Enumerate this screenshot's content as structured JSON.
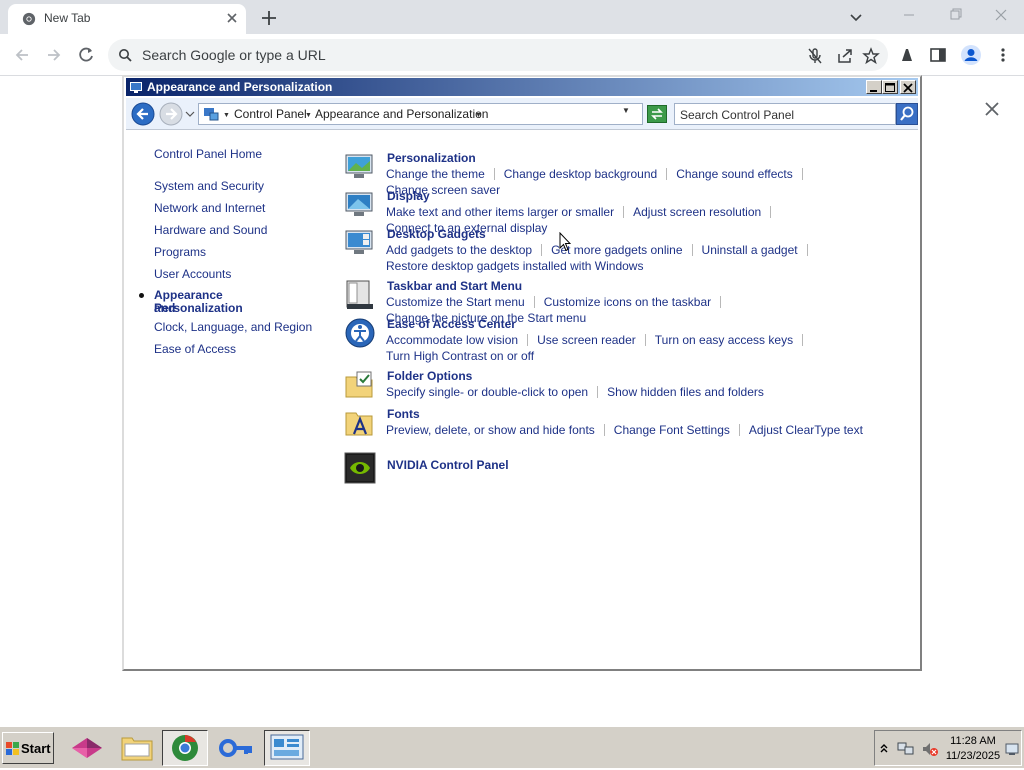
{
  "browser": {
    "tab_title": "New Tab",
    "omnibox_placeholder": "Search Google or type a URL",
    "icons": [
      "chrome-icon",
      "close-icon",
      "plus-icon",
      "chevron-down-icon",
      "minimize-icon",
      "restore-icon",
      "close-icon",
      "back-arrow-icon",
      "forward-arrow-icon",
      "reload-icon",
      "search-icon",
      "mic-off-icon",
      "share-icon",
      "star-icon",
      "extension-icon",
      "side-panel-icon",
      "profile-icon",
      "kebab-menu-icon"
    ]
  },
  "control_panel": {
    "window_title": "Appearance and Personalization",
    "breadcrumb": [
      "Control Panel",
      "Appearance and Personalization"
    ],
    "search_placeholder": "Search Control Panel",
    "nav": {
      "home": "Control Panel Home",
      "items": [
        "System and Security",
        "Network and Internet",
        "Hardware and Sound",
        "Programs",
        "User Accounts"
      ],
      "current_line1": "Appearance and",
      "current_line2": "Personalization",
      "items_after": [
        "Clock, Language, and Region",
        "Ease of Access"
      ]
    },
    "categories": [
      {
        "title": "Personalization",
        "links": [
          "Change the theme",
          "Change desktop background",
          "Change sound effects",
          "Change screen saver"
        ]
      },
      {
        "title": "Display",
        "links": [
          "Make text and other items larger or smaller",
          "Adjust screen resolution",
          "Connect to an external display"
        ]
      },
      {
        "title": "Desktop Gadgets",
        "links": [
          "Add gadgets to the desktop",
          "Get more gadgets online",
          "Uninstall a gadget",
          "Restore desktop gadgets installed with Windows"
        ]
      },
      {
        "title": "Taskbar and Start Menu",
        "links": [
          "Customize the Start menu",
          "Customize icons on the taskbar",
          "Change the picture on the Start menu"
        ]
      },
      {
        "title": "Ease of Access Center",
        "links": [
          "Accommodate low vision",
          "Use screen reader",
          "Turn on easy access keys",
          "Turn High Contrast on or off"
        ]
      },
      {
        "title": "Folder Options",
        "links": [
          "Specify single- or double-click to open",
          "Show hidden files and folders"
        ]
      },
      {
        "title": "Fonts",
        "links": [
          "Preview, delete, or show and hide fonts",
          "Change Font Settings",
          "Adjust ClearType text"
        ]
      },
      {
        "title": "NVIDIA Control Panel",
        "links": []
      }
    ]
  },
  "taskbar": {
    "start_label": "Start",
    "clock_time": "11:28 AM",
    "clock_date": "11/23/2025"
  },
  "colors": {
    "link_blue": "#1e3287",
    "titlebar_start": "#0a246a",
    "titlebar_end": "#a6caf0",
    "taskbar_gray": "#d4d0c8"
  }
}
